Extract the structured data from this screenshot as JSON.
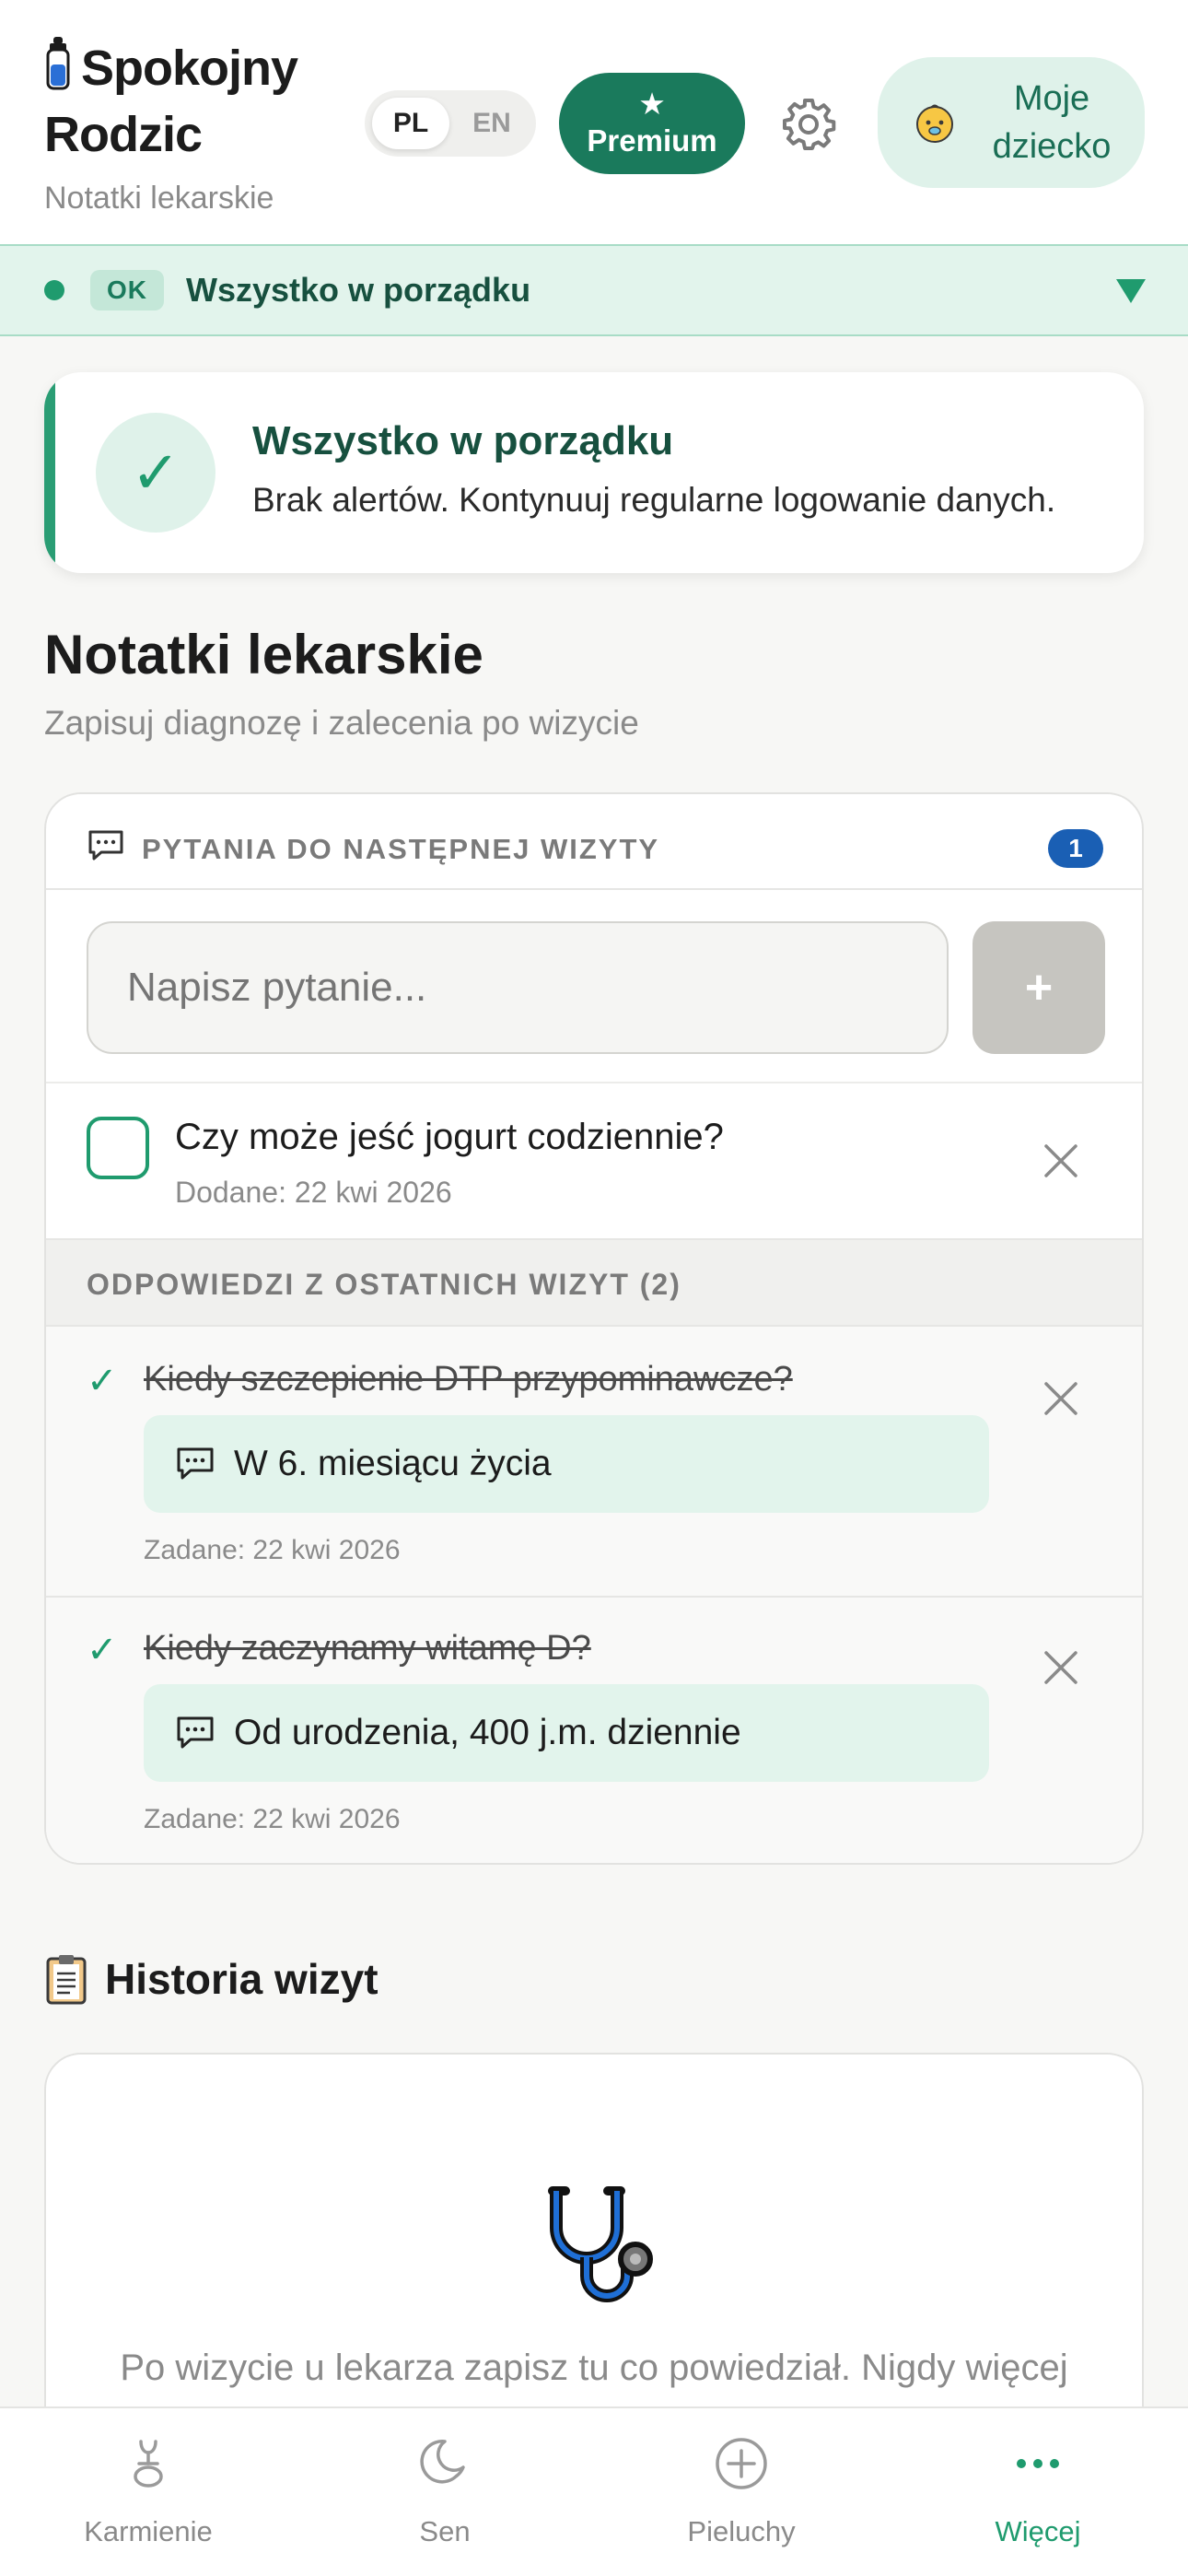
{
  "header": {
    "app_title_line1": "Spokojny",
    "app_title_line2": "Rodzic",
    "app_subtitle": "Notatki lekarskie",
    "lang_pl": "PL",
    "lang_en": "EN",
    "lang_selected": "PL",
    "premium_star": "★",
    "premium_label": "Premium",
    "child_label_line1": "Moje",
    "child_label_line2": "dziecko"
  },
  "status_bar": {
    "badge": "OK",
    "text": "Wszystko w porządku"
  },
  "ok_card": {
    "check": "✓",
    "title": "Wszystko w porządku",
    "description": "Brak alertów. Kontynuuj regularne logowanie danych."
  },
  "page": {
    "title": "Notatki lekarskie",
    "subtitle": "Zapisuj diagnozę i zalecenia po wizycie"
  },
  "questions": {
    "header_label": "PYTANIA DO NASTĘPNEJ WIZYTY",
    "count": "1",
    "input_placeholder": "Napisz pytanie...",
    "add_label": "+",
    "items": [
      {
        "text": "Czy może jeść jogurt codziennie?",
        "date": "Dodane: 22 kwi 2026"
      }
    ]
  },
  "answers": {
    "header_label": "ODPOWIEDZI Z OSTATNICH WIZYT (2)",
    "check": "✓",
    "items": [
      {
        "question": "Kiedy szczepienie DTP przypominawcze?",
        "answer": "W 6. miesiącu życia",
        "date": "Zadane: 22 kwi 2026"
      },
      {
        "question": "Kiedy zaczynamy witamę D?",
        "answer": "Od urodzenia, 400 j.m. dziennie",
        "date": "Zadane: 22 kwi 2026"
      }
    ]
  },
  "history": {
    "title": "Historia wizyt",
    "empty_text": "Po wizycie u lekarza zapisz tu co powiedział. Nigdy więcej"
  },
  "nav": {
    "items": [
      {
        "label": "Karmienie",
        "icon": "bottle-icon"
      },
      {
        "label": "Sen",
        "icon": "moon-icon"
      },
      {
        "label": "Pieluchy",
        "icon": "plus-circle-icon"
      },
      {
        "label": "Więcej",
        "icon": "more-dots-icon",
        "active": true
      }
    ]
  },
  "colors": {
    "accent": "#1f9b6e",
    "premium": "#1a7a5c",
    "badge_blue": "#1a5fb4"
  }
}
